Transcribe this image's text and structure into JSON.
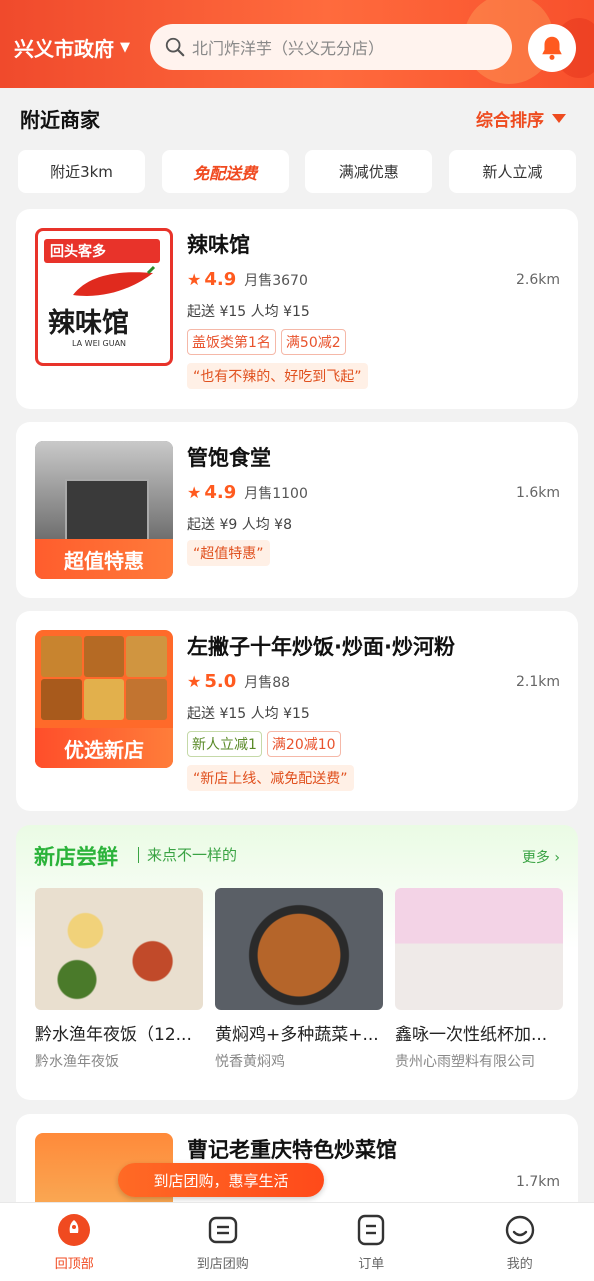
{
  "header": {
    "location": "兴义市政府",
    "search_placeholder": "北门炸洋芋（兴义无分店）"
  },
  "section": {
    "title": "附近商家",
    "sort_label": "综合排序"
  },
  "filters": [
    "附近3km",
    "免配送费",
    "满减优惠",
    "新人立减"
  ],
  "shops": [
    {
      "name": "辣味馆",
      "score": "4.9",
      "sales": "月售3670",
      "distance": "2.6km",
      "min_order": "起送 ¥15",
      "per_person": "人均 ¥15",
      "tags": [
        "盖饭类第1名",
        "满50减2"
      ],
      "quote": "“也有不辣的、好吃到飞起”",
      "thumb_ribbon": "回头客多",
      "thumb_logo": "辣味馆",
      "thumb_logo_sub": "LA WEI GUAN"
    },
    {
      "name": "管饱食堂",
      "score": "4.9",
      "sales": "月售1100",
      "distance": "1.6km",
      "min_order": "起送 ¥9",
      "per_person": "人均 ¥8",
      "tags": [],
      "quote": "“超值特惠”",
      "thumb_promo": "超值特惠"
    },
    {
      "name": "左撇子十年炒饭·炒面·炒河粉",
      "score": "5.0",
      "sales": "月售88",
      "distance": "2.1km",
      "min_order": "起送 ¥15",
      "per_person": "人均 ¥15",
      "tags": [
        "新人立减1",
        "满20减10"
      ],
      "quote": "“新店上线、减免配送费”",
      "thumb_promo": "优选新店"
    },
    {
      "name": "曹记老重庆特色炒菜馆",
      "distance": "1.7km"
    }
  ],
  "new_shops": {
    "title": "新店尝鲜",
    "subtitle": "来点不一样的",
    "more": "更多",
    "items": [
      {
        "name": "黔水渔年夜饭（12...",
        "shop": "黔水渔年夜饭"
      },
      {
        "name": "黄焖鸡+多种蔬菜+...",
        "shop": "悦香黄焖鸡"
      },
      {
        "name": "鑫咏一次性纸杯加...",
        "shop": "贵州心雨塑料有限公司"
      }
    ]
  },
  "float_banner": "到店团购，惠享生活",
  "bottom_nav": [
    {
      "label": "回顶部",
      "icon": "rocket-icon",
      "active": true
    },
    {
      "label": "到店团购",
      "icon": "store-icon"
    },
    {
      "label": "订单",
      "icon": "order-icon"
    },
    {
      "label": "我的",
      "icon": "profile-icon"
    }
  ],
  "colors": {
    "brand": "#f04a20",
    "green": "#2bb33a"
  }
}
